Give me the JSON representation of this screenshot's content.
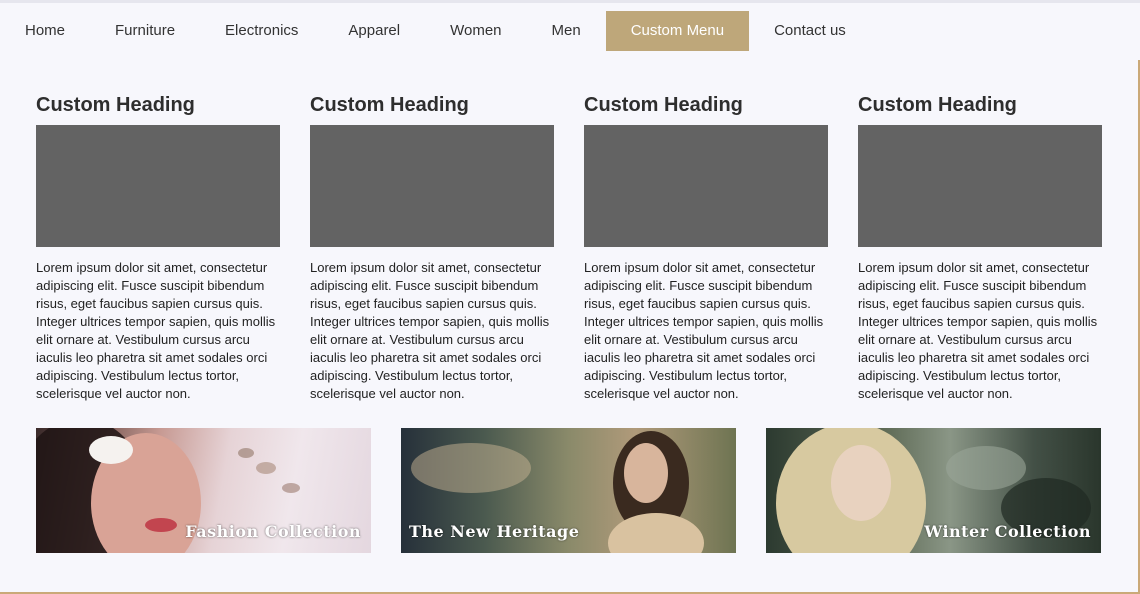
{
  "nav": {
    "items": [
      "Home",
      "Furniture",
      "Electronics",
      "Apparel",
      "Women",
      "Men",
      "Custom Menu",
      "Contact us"
    ],
    "active": "Custom Menu",
    "accent": "#bea77a"
  },
  "columns": [
    {
      "heading": "Custom Heading",
      "text": "Lorem ipsum dolor sit amet, consectetur adipiscing elit. Fusce suscipit bibendum risus, eget faucibus sapien cursus quis. Integer ultrices tempor sapien, quis mollis elit ornare at. Vestibulum cursus arcu iaculis leo pharetra sit amet sodales orci adipiscing. Vestibulum lectus tortor, scelerisque vel auctor non."
    },
    {
      "heading": "Custom Heading",
      "text": "Lorem ipsum dolor sit amet, consectetur adipiscing elit. Fusce suscipit bibendum risus, eget faucibus sapien cursus quis. Integer ultrices tempor sapien, quis mollis elit ornare at. Vestibulum cursus arcu iaculis leo pharetra sit amet sodales orci adipiscing. Vestibulum lectus tortor, scelerisque vel auctor non."
    },
    {
      "heading": "Custom Heading",
      "text": "Lorem ipsum dolor sit amet, consectetur adipiscing elit. Fusce suscipit bibendum risus, eget faucibus sapien cursus quis. Integer ultrices tempor sapien, quis mollis elit ornare at. Vestibulum cursus arcu iaculis leo pharetra sit amet sodales orci adipiscing. Vestibulum lectus tortor, scelerisque vel auctor non."
    },
    {
      "heading": "Custom Heading",
      "text": "Lorem ipsum dolor sit amet, consectetur adipiscing elit. Fusce suscipit bibendum risus, eget faucibus sapien cursus quis. Integer ultrices tempor sapien, quis mollis elit ornare at. Vestibulum cursus arcu iaculis leo pharetra sit amet sodales orci adipiscing. Vestibulum lectus tortor, scelerisque vel auctor non."
    }
  ],
  "banners": [
    {
      "caption": "Fashion Collection"
    },
    {
      "caption": "The New Heritage"
    },
    {
      "caption": "Winter Collection"
    }
  ]
}
